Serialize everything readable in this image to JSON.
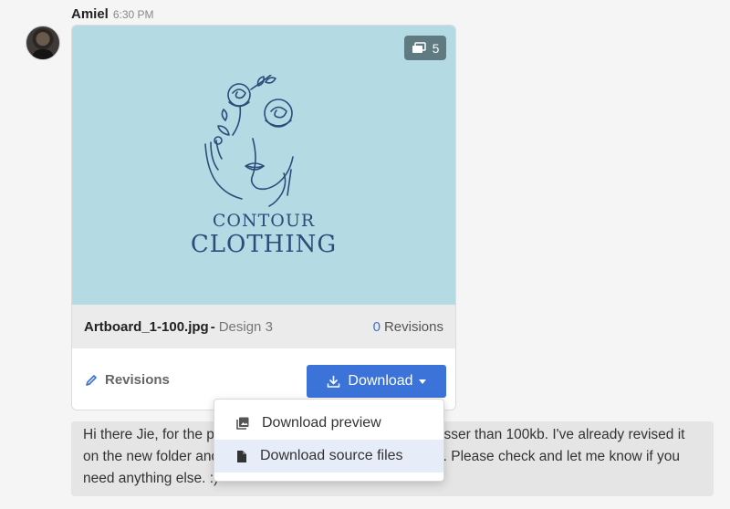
{
  "message": {
    "author": "Amiel",
    "time": "6:30 PM",
    "text": "Hi there Jie, for the preview, I need to make the 2 logos lesser than 100kb. I've already revised it on the new folder and the logo now are lesser than 100kb. Please check and let me know if you need anything else. :)"
  },
  "attachment": {
    "image_count": "5",
    "brand_line1": "CONTOUR",
    "brand_line2": "CLOTHING",
    "file_name": "Artboard_1-100.jpg",
    "separator": "-",
    "design_label": "Design 3",
    "revision_count": "0",
    "revisions_text": "Revisions",
    "revisions_link": "Revisions",
    "download_label": "Download",
    "preview_bg": "#b4dae4"
  },
  "dropdown": {
    "items": [
      {
        "label": "Download preview",
        "icon": "image-gallery-icon"
      },
      {
        "label": "Download source files",
        "icon": "file-icon"
      }
    ]
  },
  "colors": {
    "accent": "#3b73d9",
    "link": "#3b6fd9",
    "hover": "#e6edf9"
  }
}
